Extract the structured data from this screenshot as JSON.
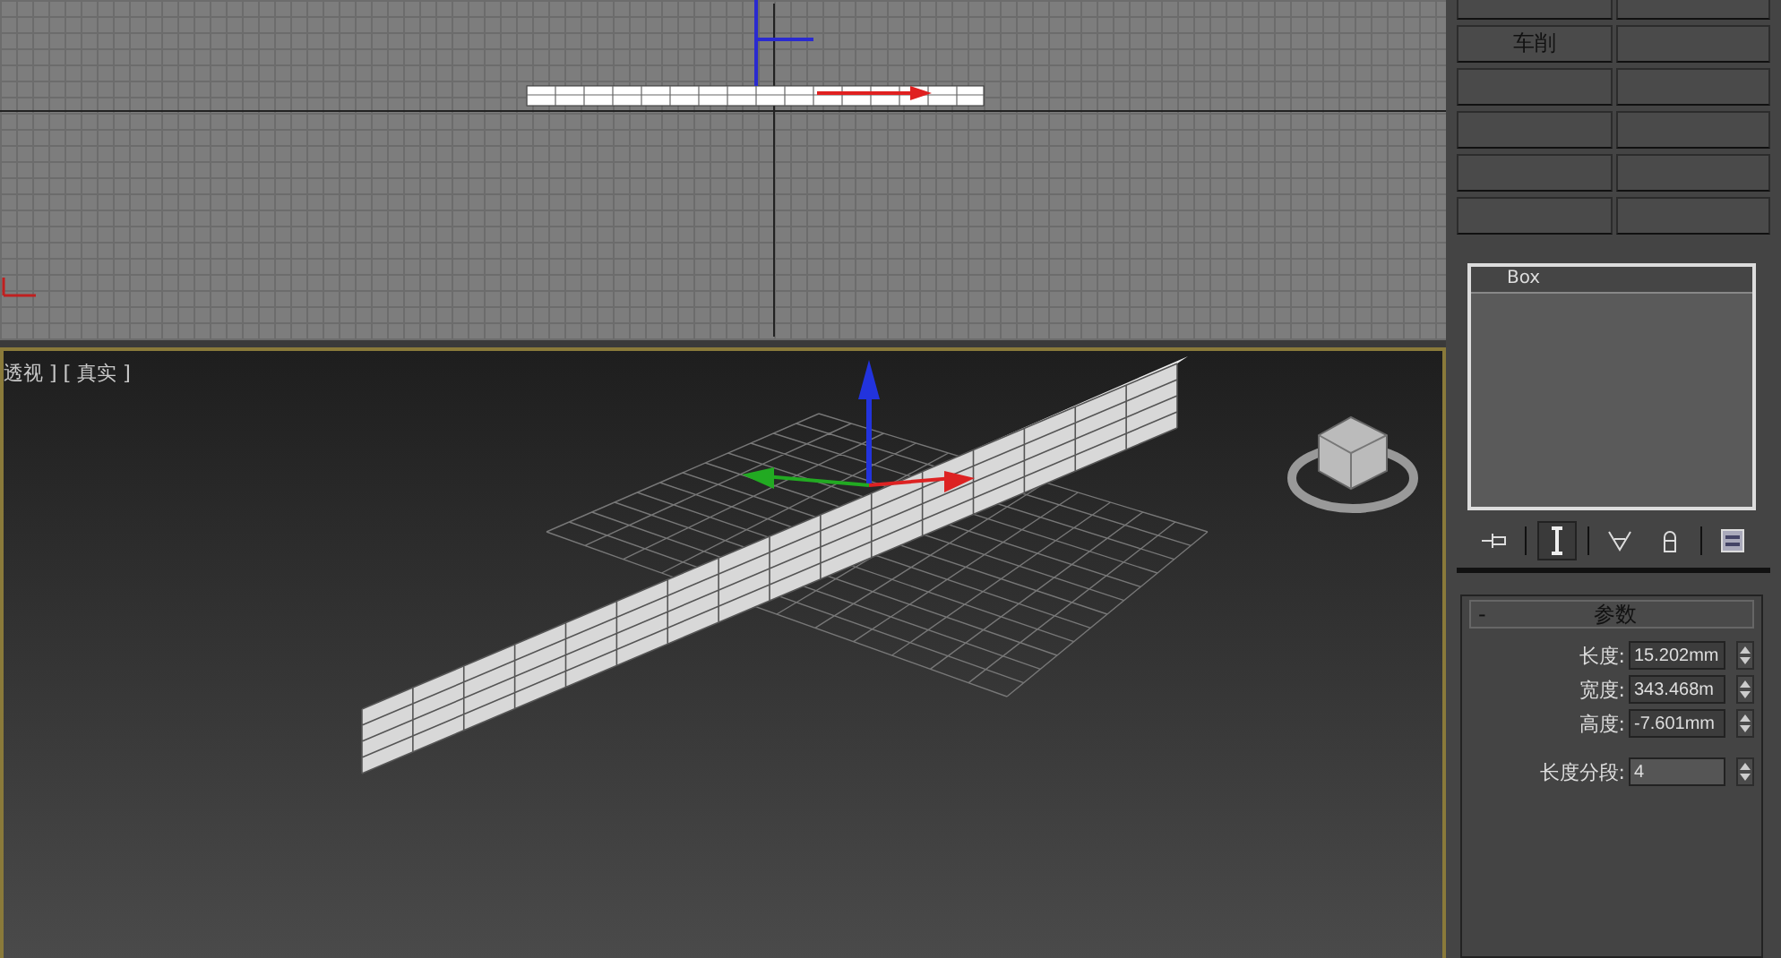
{
  "perspective_viewport": {
    "label": "透视 ] [ 真实 ]"
  },
  "command_panel": {
    "button_rows": [
      [
        {},
        {}
      ],
      [
        {
          "label": "车削"
        },
        {}
      ],
      [
        {},
        {}
      ],
      [
        {},
        {}
      ],
      [
        {},
        {}
      ],
      [
        {},
        {}
      ]
    ],
    "modifier_stack": [
      {
        "label": "Box",
        "selected": false
      }
    ],
    "stack_tools": [
      {
        "kind": "pin",
        "active": false
      },
      {
        "kind": "end",
        "active": true
      },
      {
        "kind": "unique",
        "active": false
      },
      {
        "kind": "remove",
        "active": false
      },
      {
        "kind": "configure",
        "active": false
      }
    ],
    "rollout": {
      "title": "参数",
      "toggle": "-",
      "fields": [
        {
          "label": "长度:",
          "value": "15.202mm"
        },
        {
          "label": "宽度:",
          "value": "343.468m"
        },
        {
          "label": "高度:",
          "value": "-7.601mm"
        },
        {
          "label": "长度分段:",
          "value": "4"
        }
      ]
    }
  }
}
